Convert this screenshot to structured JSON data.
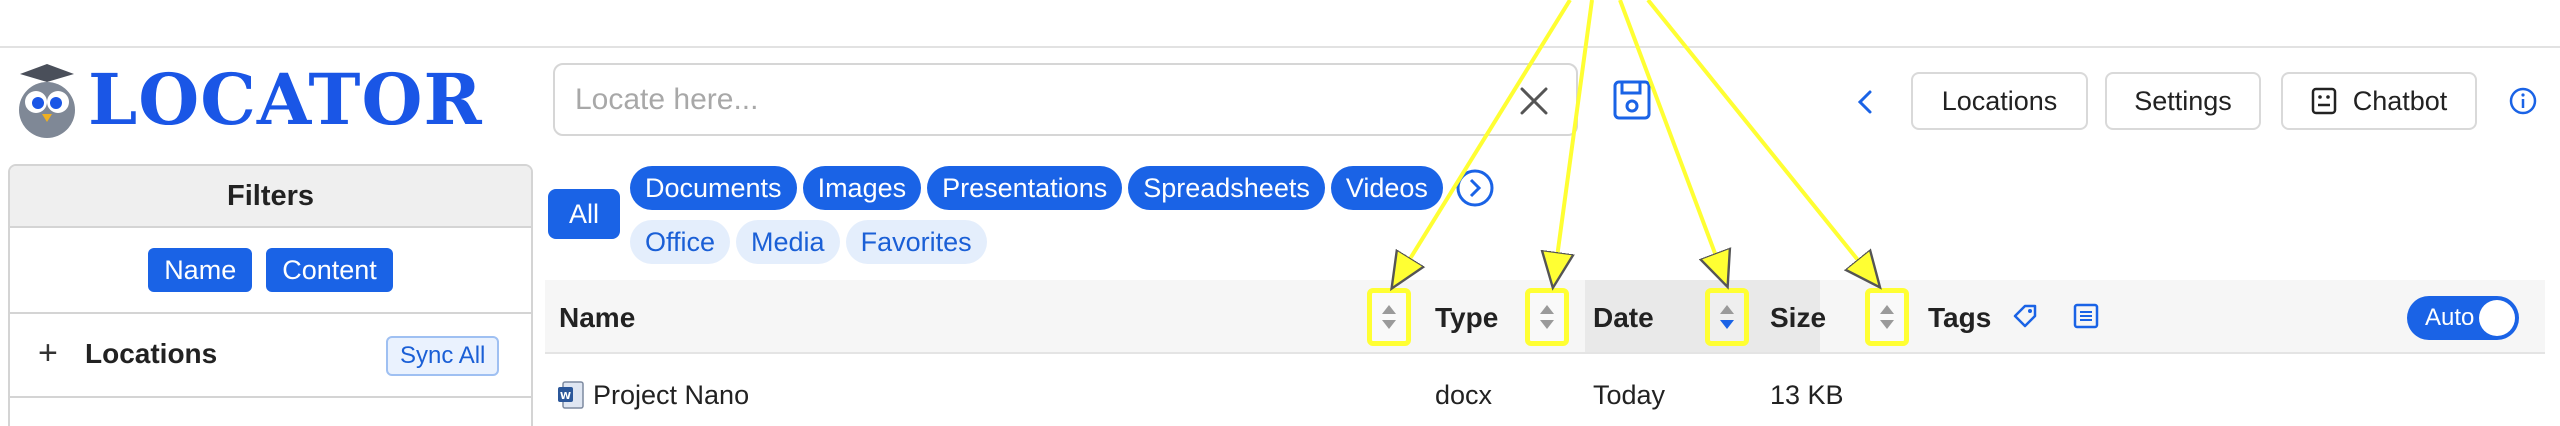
{
  "app": {
    "logo_text": "LOCATOR"
  },
  "search": {
    "placeholder": "Locate here...",
    "value": ""
  },
  "header": {
    "locations_label": "Locations",
    "settings_label": "Settings",
    "chatbot_label": "Chatbot"
  },
  "filters": {
    "title": "Filters",
    "mode_buttons": [
      "Name",
      "Content"
    ],
    "locations_label": "Locations",
    "sync_all_label": "Sync All"
  },
  "categories": {
    "all_label": "All",
    "primary": [
      "Documents",
      "Images",
      "Presentations",
      "Spreadsheets",
      "Videos"
    ],
    "secondary": [
      "Office",
      "Media",
      "Favorites"
    ]
  },
  "table": {
    "columns": {
      "name": "Name",
      "type": "Type",
      "date": "Date",
      "size": "Size",
      "tags": "Tags"
    },
    "auto_toggle_label": "Auto",
    "rows": [
      {
        "name": "Project Nano",
        "type": "docx",
        "date": "Today",
        "size": "13 KB"
      }
    ]
  },
  "colors": {
    "accent": "#1a63e6",
    "highlight": "#ffff33",
    "logo": "#1a56e6"
  }
}
